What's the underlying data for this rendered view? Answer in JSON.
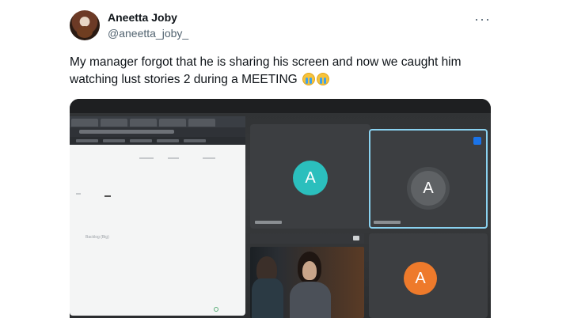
{
  "tweet": {
    "author_name": "Aneetta Joby",
    "author_handle": "@aneetta_joby_",
    "more_symbol": "···",
    "text": "My manager forgot that he is sharing his screen and now we caught him watching lust stories 2 during a MEETING"
  },
  "emojis": [
    "loudly-crying-face-emoji",
    "loudly-crying-face-emoji"
  ],
  "meeting": {
    "participants": [
      {
        "initial": "A",
        "color": "#2bbfbd"
      },
      {
        "initial": "A",
        "color": "#5f6265"
      },
      {
        "initial": "A",
        "color": "#ee7a2b"
      }
    ],
    "shared_doc_text": "Backlog (Big)"
  }
}
